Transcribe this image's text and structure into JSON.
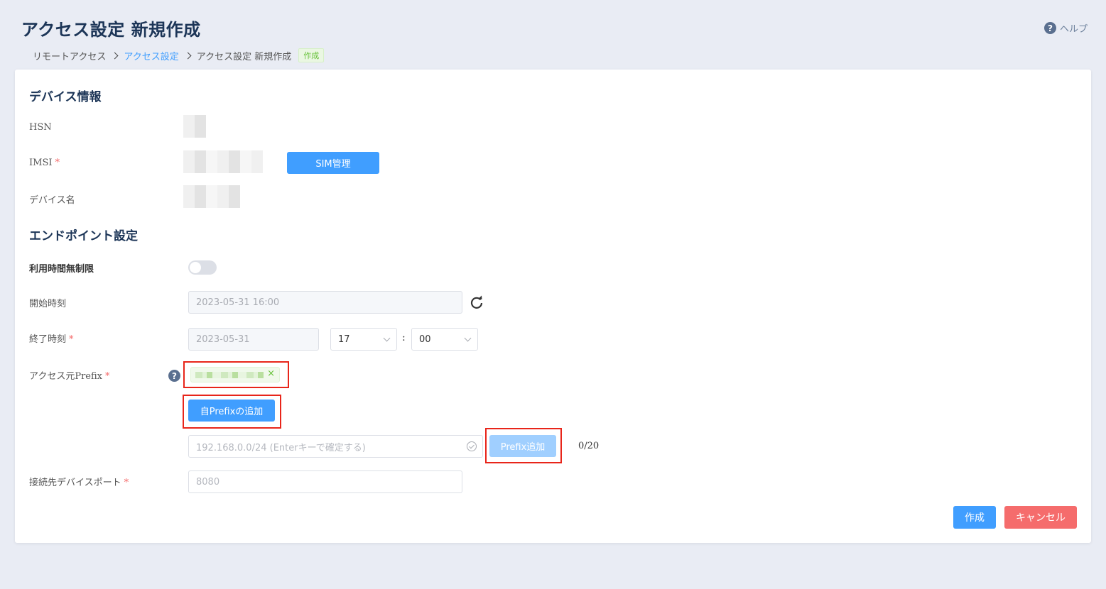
{
  "header": {
    "title": "アクセス設定 新規作成",
    "help_label": "ヘルプ"
  },
  "breadcrumb": {
    "items": [
      "リモートアクセス",
      "アクセス設定",
      "アクセス設定 新規作成"
    ],
    "badge": "作成"
  },
  "device_info": {
    "section_title": "デバイス情報",
    "hsn_label": "HSN",
    "imsi_label": "IMSI",
    "sim_button": "SIM管理",
    "device_name_label": "デバイス名"
  },
  "endpoint": {
    "section_title": "エンドポイント設定",
    "unlimited_label": "利用時間無制限",
    "unlimited_on": false,
    "start_label": "開始時刻",
    "start_value": "2023-05-31 16:00",
    "end_label": "終了時刻",
    "end_date": "2023-05-31",
    "end_hour": "17",
    "end_minute": "00",
    "time_separator": ":",
    "prefix_label": "アクセス元Prefix",
    "tag_close": "×",
    "own_prefix_button": "自Prefixの追加",
    "prefix_placeholder": "192.168.0.0/24 (Enterキーで確定する)",
    "prefix_add_button": "Prefix追加",
    "prefix_counter": "0/20",
    "port_label": "接続先デバイスポート",
    "port_placeholder": "8080",
    "required_mark": "*"
  },
  "actions": {
    "create": "作成",
    "cancel": "キャンセル"
  },
  "colors": {
    "primary": "#409eff",
    "danger": "#f56c6c",
    "highlight": "#e8251a",
    "title": "#1c3557"
  }
}
